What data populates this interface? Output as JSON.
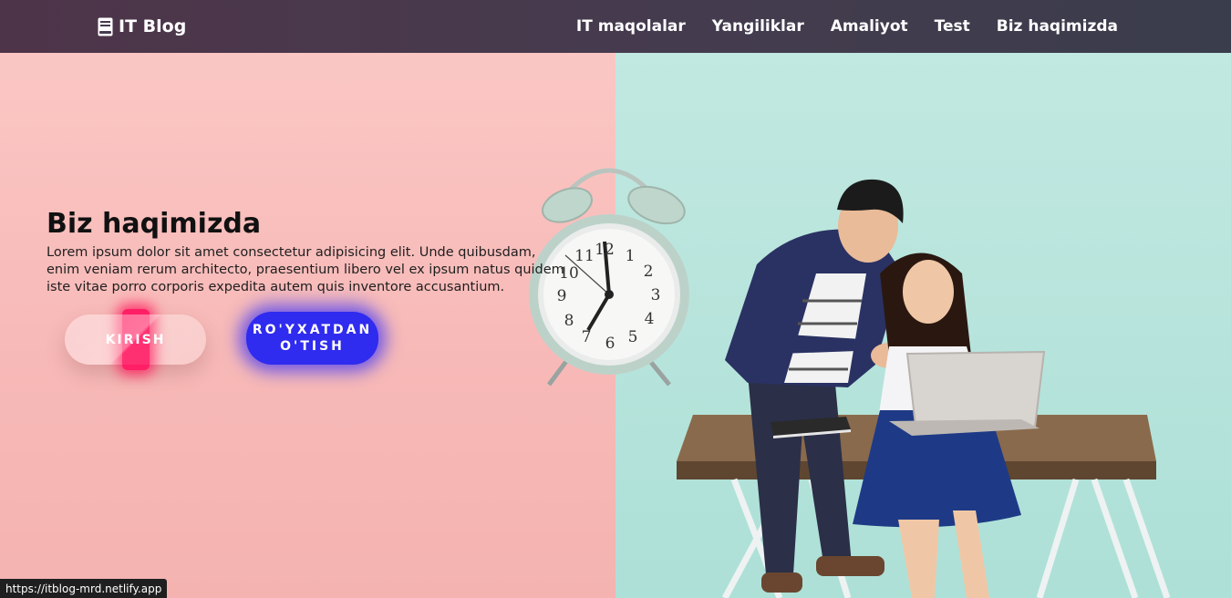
{
  "brand": {
    "icon": "book-icon",
    "name": "IT Blog"
  },
  "nav": [
    {
      "label": "IT maqolalar"
    },
    {
      "label": "Yangiliklar"
    },
    {
      "label": "Amaliyot"
    },
    {
      "label": "Test"
    },
    {
      "label": "Biz haqimizda"
    }
  ],
  "hero": {
    "title": "Biz haqimizda",
    "text": "Lorem ipsum dolor sit amet consectetur adipisicing elit. Unde quibusdam, enim veniam rerum architecto, praesentium libero vel ex ipsum natus quidem iste vitae porro corporis expedita autem quis inventore accusantium."
  },
  "buttons": {
    "login": "KIRISH",
    "register": "RO'YXATDAN O'TISH"
  },
  "clock": {
    "numbers": [
      "12",
      "1",
      "2",
      "3",
      "4",
      "5",
      "6",
      "7",
      "8",
      "9",
      "10",
      "11"
    ]
  },
  "status_bar": {
    "url": "https://itblog-mrd.netlify.app"
  },
  "colors": {
    "left_bg": "#f7bcb9",
    "right_bg": "#b6e4dc",
    "navbar": "#463b4e",
    "login_glow": "#ff1f66",
    "register": "#2f2bef"
  }
}
